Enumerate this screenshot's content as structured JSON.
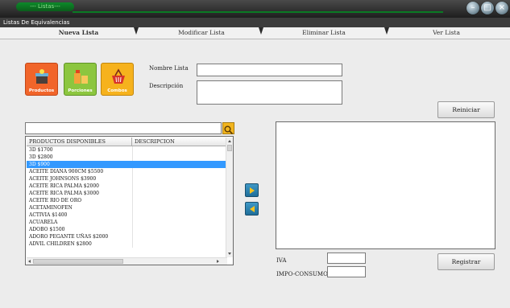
{
  "window": {
    "title": "--- Listas---",
    "controls": [
      "minimize",
      "maximize",
      "close"
    ]
  },
  "menubar": {
    "label": "Listas De Equivalencias"
  },
  "tabs": [
    {
      "label": "Nueva Lista",
      "active": true
    },
    {
      "label": "Modificar Lista",
      "active": false
    },
    {
      "label": "Eliminar Lista",
      "active": false
    },
    {
      "label": "Ver Lista",
      "active": false
    }
  ],
  "categories": [
    {
      "label": "Productos",
      "color": "#f1652a",
      "icon": "box-icon"
    },
    {
      "label": "Porciones",
      "color": "#8cc63f",
      "icon": "portions-icon"
    },
    {
      "label": "Combos",
      "color": "#f6b21d",
      "icon": "basket-icon"
    }
  ],
  "form": {
    "name_label": "Nombre Lista",
    "name_value": "",
    "description_label": "Descripción",
    "description_value": ""
  },
  "buttons": {
    "reset": "Reiniciar",
    "register": "Registrar"
  },
  "search": {
    "value": ""
  },
  "list": {
    "columns": [
      "PRODUCTOS DISPONIBLES",
      "DESCRIPCION"
    ],
    "rows": [
      {
        "product": "3D $1700",
        "description": ""
      },
      {
        "product": "3D $2800",
        "description": ""
      },
      {
        "product": "3D $900",
        "description": "",
        "selected": true
      },
      {
        "product": "ACEITE DIANA 900CM $5500",
        "description": ""
      },
      {
        "product": "ACEITE JOHNSONS $3900",
        "description": ""
      },
      {
        "product": "ACEITE RICA PALMA $2000",
        "description": ""
      },
      {
        "product": "ACEITE RICA PALMA $3000",
        "description": ""
      },
      {
        "product": "ACEITE RIO DE ORO",
        "description": ""
      },
      {
        "product": "ACETAMINOFEN",
        "description": ""
      },
      {
        "product": "ACTIVIA $1400",
        "description": ""
      },
      {
        "product": "ACUARELA",
        "description": ""
      },
      {
        "product": "ADOBO $1500",
        "description": ""
      },
      {
        "product": "ADORO PEGANTE UÑAS $2000",
        "description": ""
      },
      {
        "product": "ADVIL CHILDREN $2800",
        "description": ""
      }
    ]
  },
  "taxes": {
    "iva_label": "IVA",
    "iva_value": "",
    "impo_label": "IMPO-CONSUMO",
    "impo_value": ""
  },
  "colors": {
    "accent_button": "#2a82b3",
    "search_button": "#f2b51e",
    "selection": "#3399ff"
  }
}
